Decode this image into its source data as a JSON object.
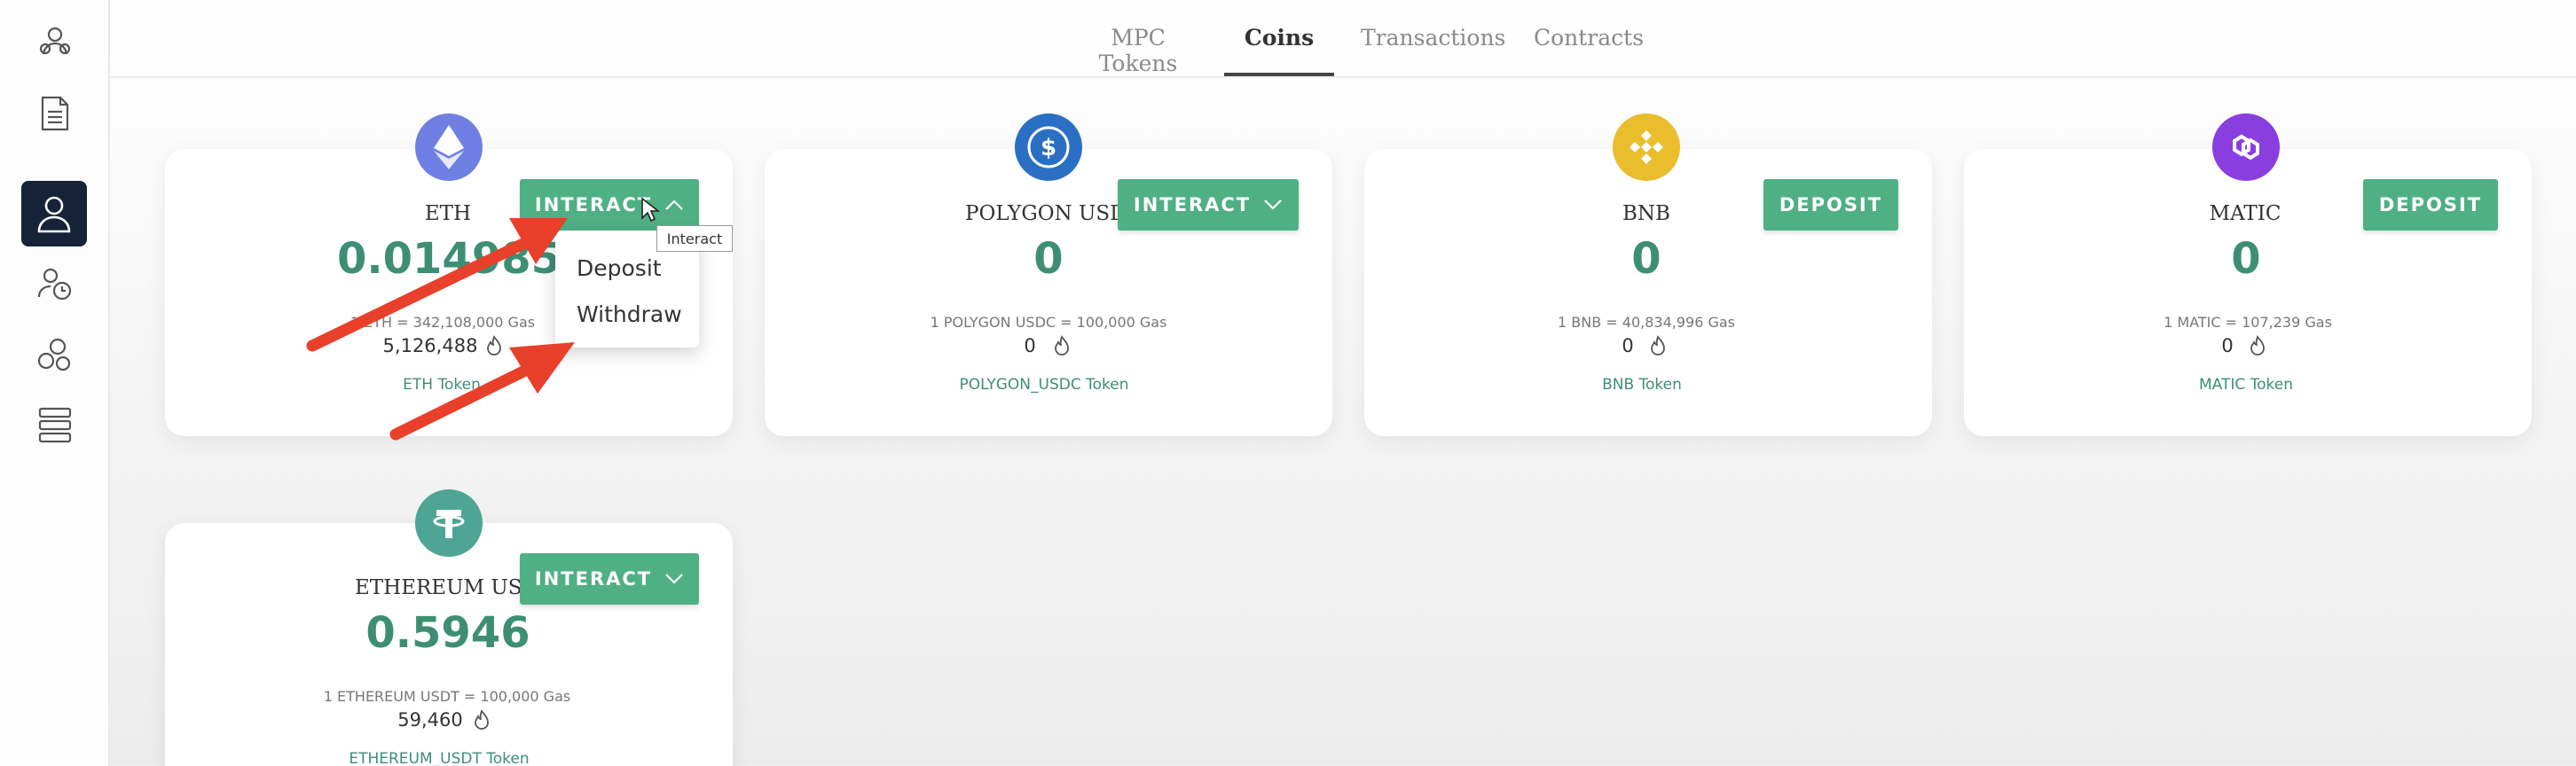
{
  "tabs": [
    "MPC Tokens",
    "Coins",
    "Transactions",
    "Contracts"
  ],
  "sidebar": [
    "team-icon",
    "document-icon",
    "user-icon",
    "user-clock-icon",
    "network-icon",
    "server-icon"
  ],
  "cards": [
    {
      "name": "ETH",
      "balance": "0.014985",
      "rate": "1 ETH = 342,108,000 Gas",
      "gas": "5,126,488",
      "token": "ETH Token",
      "button": "INTERACT",
      "icon": "ethereum-icon"
    },
    {
      "name": "POLYGON USDC",
      "balance": "0",
      "rate": "1 POLYGON USDC = 100,000 Gas",
      "gas": "0",
      "token": "POLYGON_USDC Token",
      "button": "INTERACT",
      "icon": "usdc-icon"
    },
    {
      "name": "BNB",
      "balance": "0",
      "rate": "1 BNB = 40,834,996 Gas",
      "gas": "0",
      "token": "BNB Token",
      "button": "DEPOSIT",
      "icon": "bnb-icon"
    },
    {
      "name": "MATIC",
      "balance": "0",
      "rate": "1 MATIC = 107,239 Gas",
      "gas": "0",
      "token": "MATIC Token",
      "button": "DEPOSIT",
      "icon": "polygon-icon"
    },
    {
      "name": "ETHEREUM USDT",
      "balance": "0.5946",
      "rate": "1 ETHEREUM USDT = 100,000 Gas",
      "gas": "59,460",
      "token": "ETHEREUM_USDT Token",
      "button": "INTERACT",
      "icon": "tether-icon"
    }
  ],
  "dropdown": {
    "items": [
      "Deposit",
      "Withdraw"
    ]
  },
  "tooltip": "Interact",
  "colors": {
    "accent": "#4fb084",
    "balance": "#3e8f72",
    "active_sidebar": "#152238",
    "arrow": "#e8402a"
  }
}
